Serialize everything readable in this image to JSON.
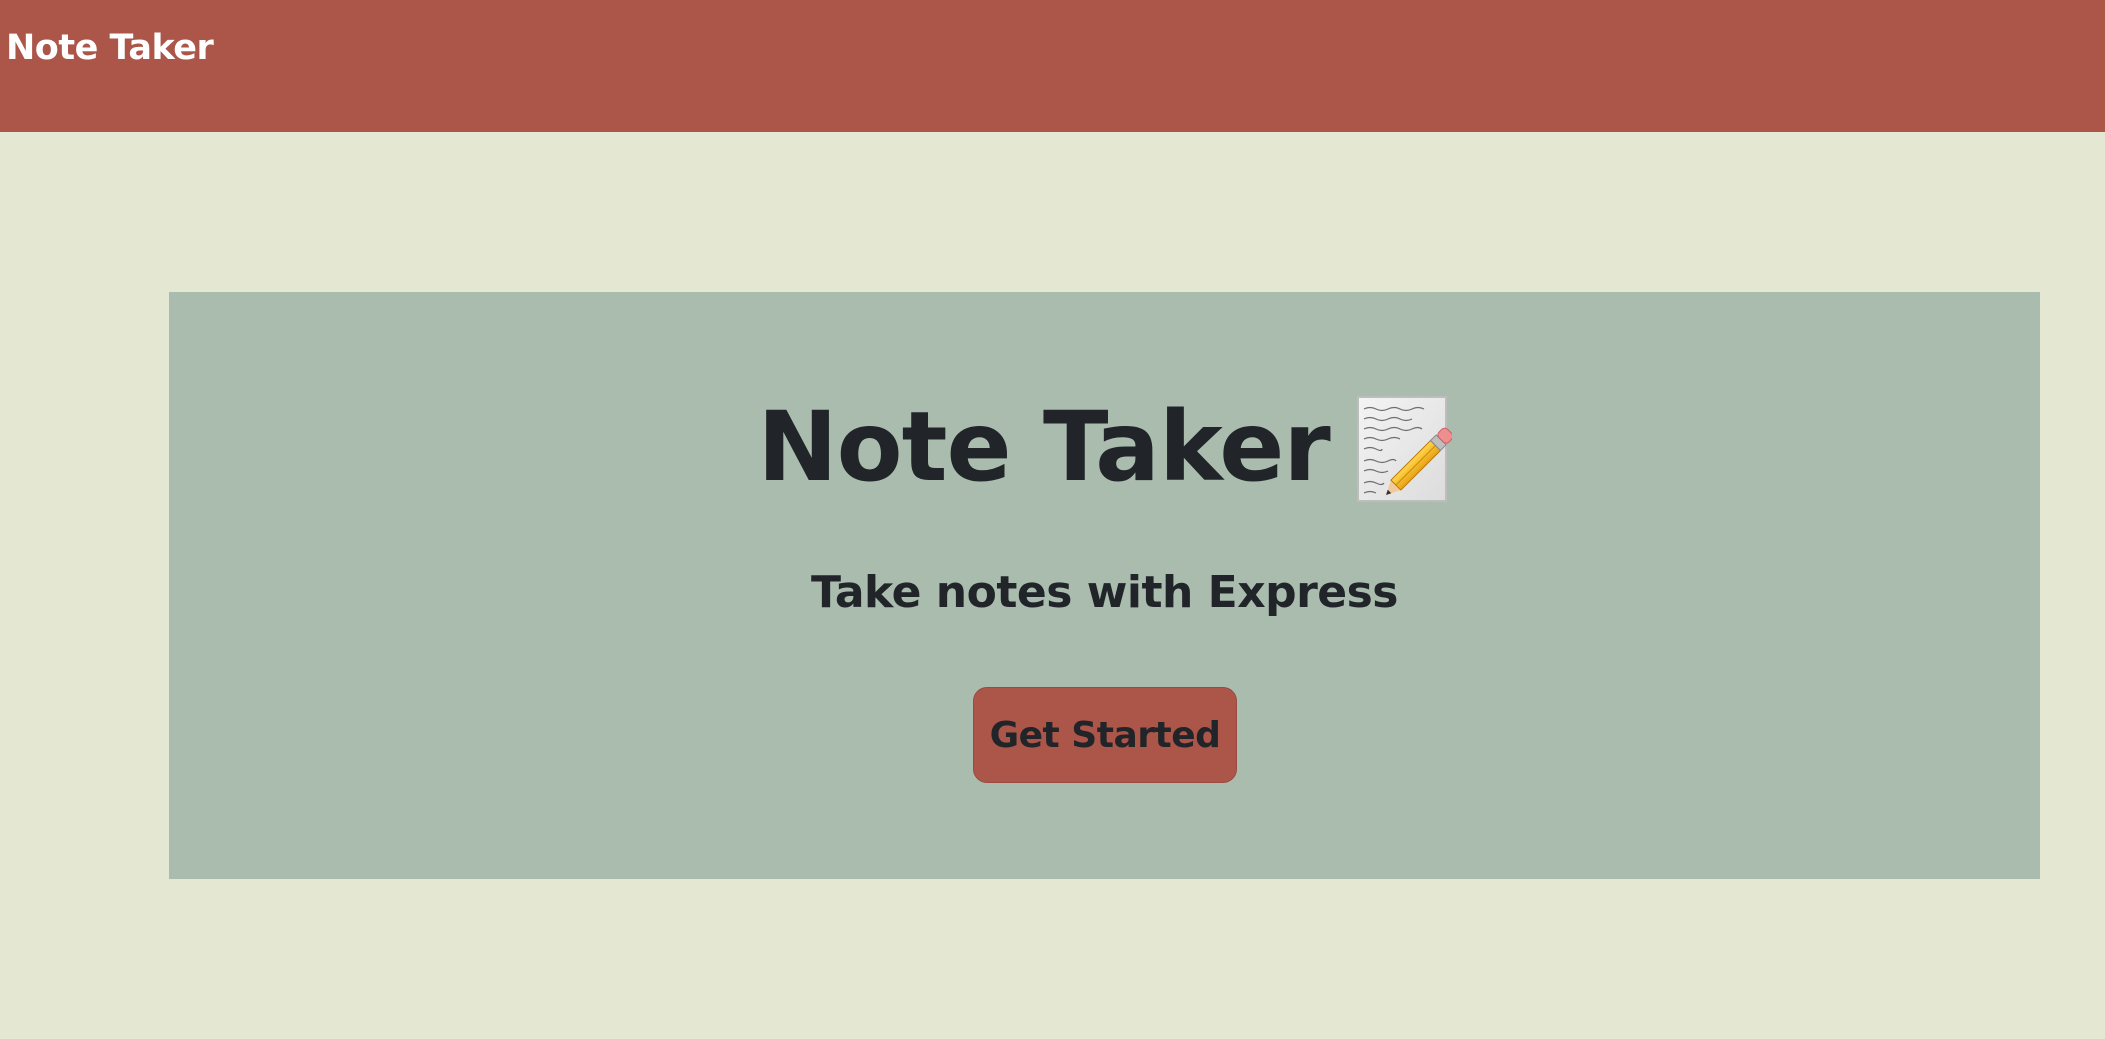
{
  "navbar": {
    "brand": "Note Taker",
    "color": "#ac5549"
  },
  "hero": {
    "title": "Note Taker",
    "title_icon": "memo-icon",
    "subtitle": "Take notes with Express",
    "cta_label": "Get Started",
    "background": "#aabcae"
  },
  "page": {
    "background": "#e4e7d2",
    "accent": "#ac5549",
    "text_color": "#212529"
  }
}
